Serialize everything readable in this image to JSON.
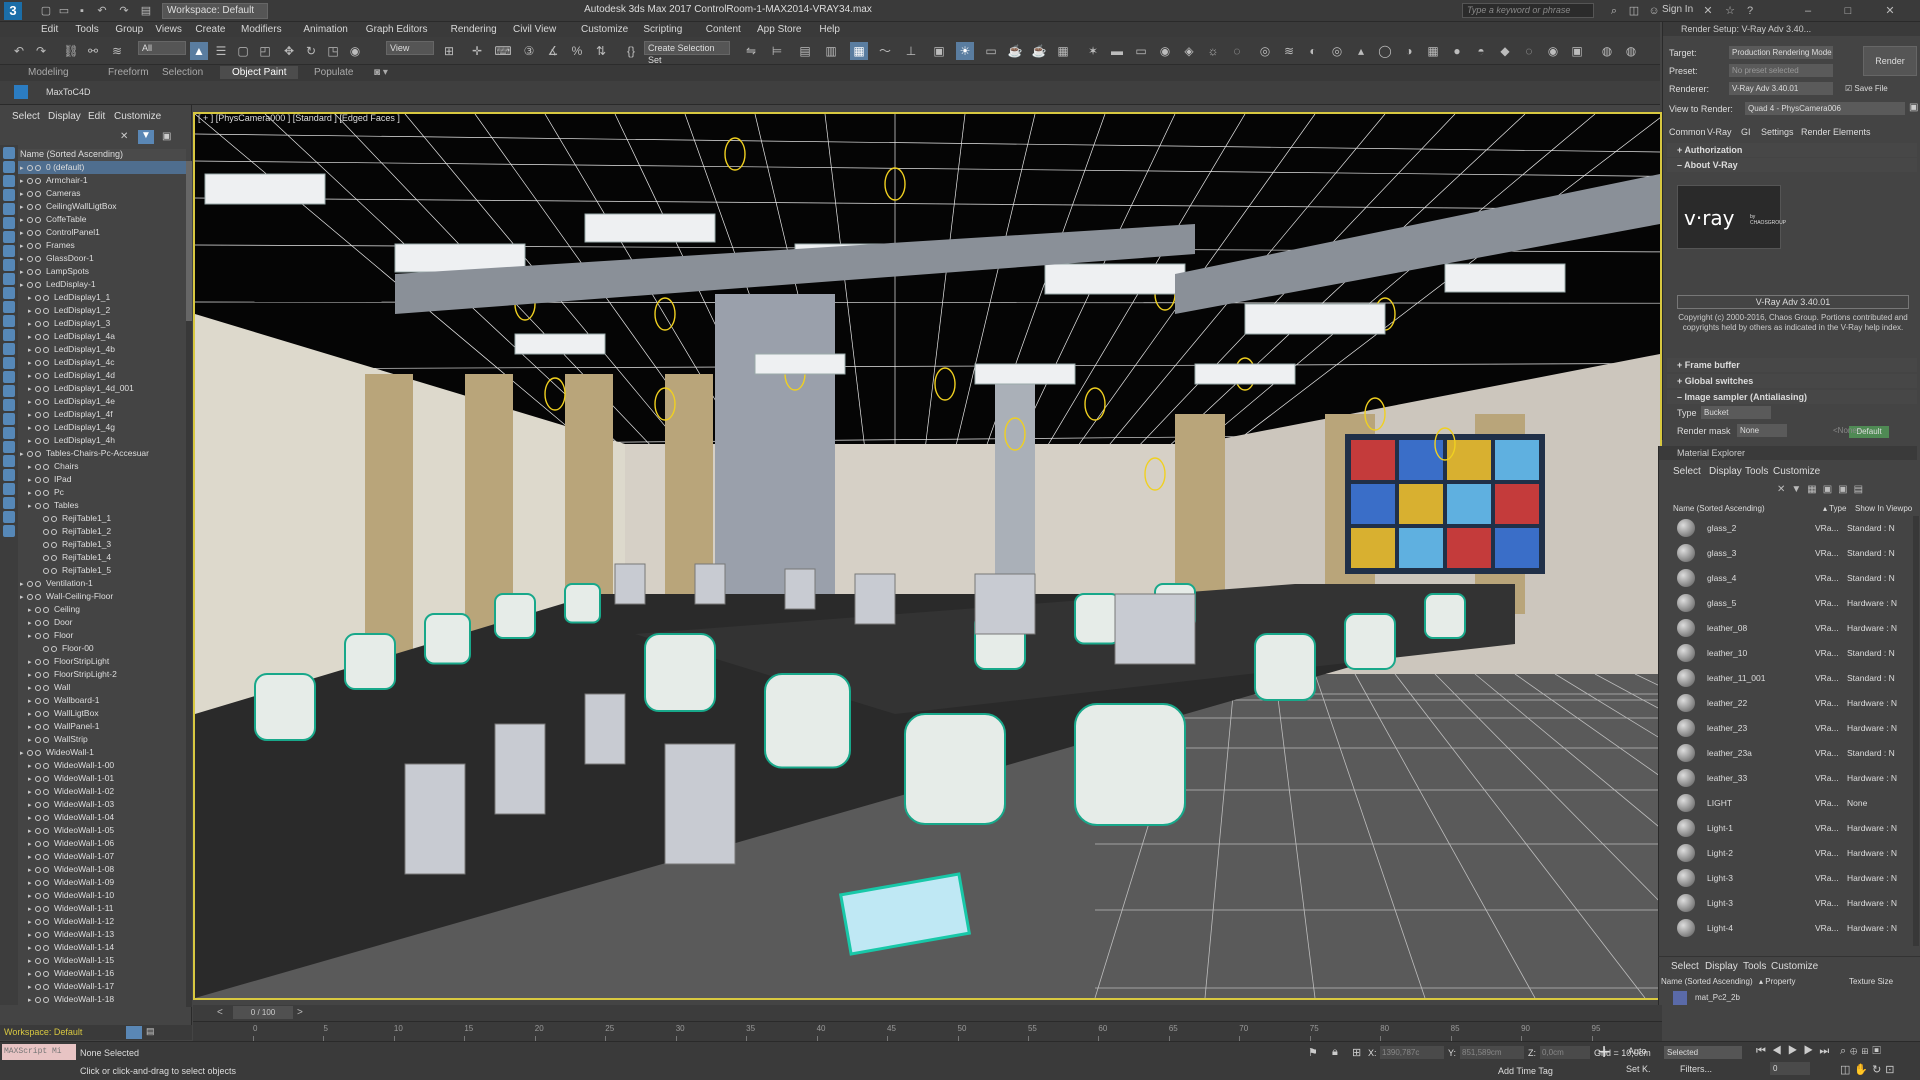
{
  "titlebar": {
    "workspace": "Workspace: Default",
    "app_title": "Autodesk 3ds Max 2017     ControlRoom-1-MAX2014-VRAY34.max",
    "search_placeholder": "Type a keyword or phrase",
    "sign_in": "Sign In"
  },
  "menu": [
    "Edit",
    "Tools",
    "Group",
    "Views",
    "Create",
    "Modifiers",
    "Animation",
    "Graph Editors",
    "Rendering",
    "Civil View",
    "Customize",
    "Scripting",
    "Content",
    "App Store",
    "Help"
  ],
  "toolbar": {
    "filter": "All",
    "view": "View",
    "selection_set": "Create Selection Set"
  },
  "ribbon": {
    "tabs": [
      "Modeling",
      "Freeform",
      "Selection",
      "Object Paint",
      "Populate"
    ],
    "active_tab": "Object Paint",
    "plugin_label": "MaxToC4D"
  },
  "scene_explorer": {
    "menu": [
      "Select",
      "Display",
      "Edit",
      "Customize"
    ],
    "column_header": "Name (Sorted Ascending)",
    "items": [
      {
        "name": "0 (default)",
        "lvl": 1,
        "sel": true
      },
      {
        "name": "Armchair-1",
        "lvl": 1
      },
      {
        "name": "Cameras",
        "lvl": 1
      },
      {
        "name": "CeilingWallLigtBox",
        "lvl": 1
      },
      {
        "name": "CoffeTable",
        "lvl": 1
      },
      {
        "name": "ControlPanel1",
        "lvl": 1
      },
      {
        "name": "Frames",
        "lvl": 1
      },
      {
        "name": "GlassDoor-1",
        "lvl": 1
      },
      {
        "name": "LampSpots",
        "lvl": 1
      },
      {
        "name": "LedDisplay-1",
        "lvl": 1
      },
      {
        "name": "LedDisplay1_1",
        "lvl": 2
      },
      {
        "name": "LedDisplay1_2",
        "lvl": 2
      },
      {
        "name": "LedDisplay1_3",
        "lvl": 2
      },
      {
        "name": "LedDisplay1_4a",
        "lvl": 2
      },
      {
        "name": "LedDisplay1_4b",
        "lvl": 2
      },
      {
        "name": "LedDisplay1_4c",
        "lvl": 2
      },
      {
        "name": "LedDisplay1_4d",
        "lvl": 2
      },
      {
        "name": "LedDisplay1_4d_001",
        "lvl": 2
      },
      {
        "name": "LedDisplay1_4e",
        "lvl": 2
      },
      {
        "name": "LedDisplay1_4f",
        "lvl": 2
      },
      {
        "name": "LedDisplay1_4g",
        "lvl": 2
      },
      {
        "name": "LedDisplay1_4h",
        "lvl": 2
      },
      {
        "name": "Tables-Chairs-Pc-Accesuar",
        "lvl": 1
      },
      {
        "name": "Chairs",
        "lvl": 2
      },
      {
        "name": "IPad",
        "lvl": 2
      },
      {
        "name": "Pc",
        "lvl": 2
      },
      {
        "name": "Tables",
        "lvl": 2
      },
      {
        "name": "RejiTable1_1",
        "lvl": 3
      },
      {
        "name": "RejiTable1_2",
        "lvl": 3
      },
      {
        "name": "RejiTable1_3",
        "lvl": 3
      },
      {
        "name": "RejiTable1_4",
        "lvl": 3
      },
      {
        "name": "RejiTable1_5",
        "lvl": 3
      },
      {
        "name": "Ventilation-1",
        "lvl": 1
      },
      {
        "name": "Wall-Ceiling-Floor",
        "lvl": 1
      },
      {
        "name": "Ceiling",
        "lvl": 2
      },
      {
        "name": "Door",
        "lvl": 2
      },
      {
        "name": "Floor",
        "lvl": 2
      },
      {
        "name": "Floor-00",
        "lvl": 3
      },
      {
        "name": "FloorStripLight",
        "lvl": 2
      },
      {
        "name": "FloorStripLight-2",
        "lvl": 2
      },
      {
        "name": "Wall",
        "lvl": 2
      },
      {
        "name": "Wallboard-1",
        "lvl": 2
      },
      {
        "name": "WallLigtBox",
        "lvl": 2
      },
      {
        "name": "WallPanel-1",
        "lvl": 2
      },
      {
        "name": "WallStrip",
        "lvl": 2
      },
      {
        "name": "WideoWall-1",
        "lvl": 1
      },
      {
        "name": "WideoWall-1-00",
        "lvl": 2
      },
      {
        "name": "WideoWall-1-01",
        "lvl": 2
      },
      {
        "name": "WideoWall-1-02",
        "lvl": 2
      },
      {
        "name": "WideoWall-1-03",
        "lvl": 2
      },
      {
        "name": "WideoWall-1-04",
        "lvl": 2
      },
      {
        "name": "WideoWall-1-05",
        "lvl": 2
      },
      {
        "name": "WideoWall-1-06",
        "lvl": 2
      },
      {
        "name": "WideoWall-1-07",
        "lvl": 2
      },
      {
        "name": "WideoWall-1-08",
        "lvl": 2
      },
      {
        "name": "WideoWall-1-09",
        "lvl": 2
      },
      {
        "name": "WideoWall-1-10",
        "lvl": 2
      },
      {
        "name": "WideoWall-1-11",
        "lvl": 2
      },
      {
        "name": "WideoWall-1-12",
        "lvl": 2
      },
      {
        "name": "WideoWall-1-13",
        "lvl": 2
      },
      {
        "name": "WideoWall-1-14",
        "lvl": 2
      },
      {
        "name": "WideoWall-1-15",
        "lvl": 2
      },
      {
        "name": "WideoWall-1-16",
        "lvl": 2
      },
      {
        "name": "WideoWall-1-17",
        "lvl": 2
      },
      {
        "name": "WideoWall-1-18",
        "lvl": 2
      }
    ],
    "footer": "Workspace: Default"
  },
  "viewport": {
    "label": "[ + ] [PhysCamera000 ] [Standard ] [Edged Faces ]"
  },
  "render_setup": {
    "title": "Render Setup: V-Ray Adv 3.40...",
    "target_label": "Target:",
    "target": "Production Rendering Mode",
    "preset_label": "Preset:",
    "preset": "No preset selected",
    "renderer_label": "Renderer:",
    "renderer": "V-Ray Adv 3.40.01",
    "save_file": "Save File",
    "render_button": "Render",
    "view_label": "View to Render:",
    "view": "Quad 4 - PhysCamera006",
    "tabs": [
      "Common",
      "V-Ray",
      "GI",
      "Settings",
      "Render Elements"
    ],
    "sections": {
      "authorization": "Authorization",
      "about": "About V-Ray",
      "frame_buffer": "Frame buffer",
      "global_switches": "Global switches",
      "image_sampler": "Image sampler (Antialiasing)"
    },
    "logo_text": "v·ray",
    "logo_by": "by CHAOSGROUP",
    "version": "V-Ray Adv 3.40.01",
    "copyright": "Copyright (c) 2000-2016, Chaos Group. Portions contributed and copyrights held by others as indicated in the V-Ray help index.",
    "type_label": "Type",
    "type": "Bucket",
    "default_btn": "Default",
    "render_mask_label": "Render mask",
    "render_mask": "None",
    "none_tag": "<None>"
  },
  "material_explorer": {
    "title": "Material Explorer",
    "menu": [
      "Select",
      "Display",
      "Tools",
      "Customize"
    ],
    "col_name": "Name (Sorted Ascending)",
    "col_type": "▴ Type",
    "col_show": "Show In Viewpo",
    "rows": [
      {
        "name": "glass_2",
        "type": "VRa...",
        "show": "Standard : N"
      },
      {
        "name": "glass_3",
        "type": "VRa...",
        "show": "Standard : N"
      },
      {
        "name": "glass_4",
        "type": "VRa...",
        "show": "Standard : N"
      },
      {
        "name": "glass_5",
        "type": "VRa...",
        "show": "Hardware : N"
      },
      {
        "name": "leather_08",
        "type": "VRa...",
        "show": "Hardware : N"
      },
      {
        "name": "leather_10",
        "type": "VRa...",
        "show": "Standard : N"
      },
      {
        "name": "leather_11_001",
        "type": "VRa...",
        "show": "Standard : N"
      },
      {
        "name": "leather_22",
        "type": "VRa...",
        "show": "Hardware : N"
      },
      {
        "name": "leather_23",
        "type": "VRa...",
        "show": "Hardware : N"
      },
      {
        "name": "leather_23a",
        "type": "VRa...",
        "show": "Standard : N"
      },
      {
        "name": "leather_33",
        "type": "VRa...",
        "show": "Hardware : N"
      },
      {
        "name": "LIGHT",
        "type": "VRa...",
        "show": "None"
      },
      {
        "name": "Light-1",
        "type": "VRa...",
        "show": "Hardware : N"
      },
      {
        "name": "Light-2",
        "type": "VRa...",
        "show": "Hardware : N"
      },
      {
        "name": "Light-3",
        "type": "VRa...",
        "show": "Hardware : N"
      },
      {
        "name": "Light-3",
        "type": "VRa...",
        "show": "Hardware : N"
      },
      {
        "name": "Light-4",
        "type": "VRa...",
        "show": "Hardware : N"
      }
    ],
    "lower_menu": [
      "Select",
      "Display",
      "Tools",
      "Customize"
    ],
    "lower_col_name": "Name (Sorted Ascending)",
    "lower_col_prop": "▴ Property",
    "lower_col_tex": "Texture Size",
    "lower_row": "mat_Pc2_2b"
  },
  "timeline": {
    "frame": "0 / 100",
    "ticks": [
      "0",
      "5",
      "10",
      "15",
      "20",
      "25",
      "30",
      "35",
      "40",
      "45",
      "50",
      "55",
      "60",
      "65",
      "70",
      "75",
      "80",
      "85",
      "90",
      "95"
    ]
  },
  "status": {
    "maxscript": "MAXScript Mi",
    "selection": "None Selected",
    "prompt": "Click or click-and-drag to select objects",
    "x_label": "X:",
    "x": "1390,787c",
    "y_label": "Y:",
    "y": "851,589cm",
    "z_label": "Z:",
    "z": "0,0cm",
    "grid": "Grid = 10,0cm",
    "add_time_tag": "Add Time Tag",
    "auto": "Auto",
    "set_k": "Set K.",
    "selected": "Selected",
    "filters": "Filters...",
    "frame_field": "0"
  }
}
